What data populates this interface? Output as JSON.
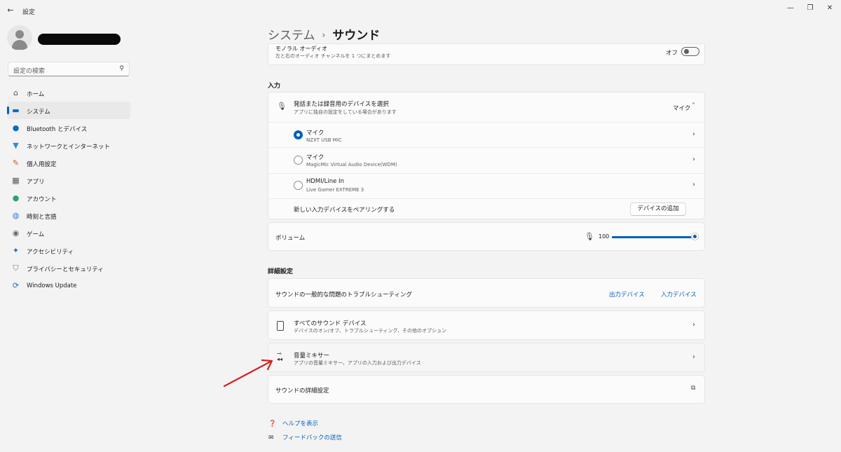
{
  "window": {
    "title": "設定"
  },
  "sidebar": {
    "search_placeholder": "設定の検索",
    "items": [
      {
        "label": "ホーム",
        "icon": "home-icon",
        "active": false
      },
      {
        "label": "システム",
        "icon": "system-icon",
        "active": true
      },
      {
        "label": "Bluetooth とデバイス",
        "icon": "bluetooth-icon",
        "active": false
      },
      {
        "label": "ネットワークとインターネット",
        "icon": "network-icon",
        "active": false
      },
      {
        "label": "個人用設定",
        "icon": "personalization-icon",
        "active": false
      },
      {
        "label": "アプリ",
        "icon": "apps-icon",
        "active": false
      },
      {
        "label": "アカウント",
        "icon": "account-icon",
        "active": false
      },
      {
        "label": "時刻と言語",
        "icon": "time-language-icon",
        "active": false
      },
      {
        "label": "ゲーム",
        "icon": "gaming-icon",
        "active": false
      },
      {
        "label": "アクセシビリティ",
        "icon": "accessibility-icon",
        "active": false
      },
      {
        "label": "プライバシーとセキュリティ",
        "icon": "privacy-icon",
        "active": false
      },
      {
        "label": "Windows Update",
        "icon": "windows-update-icon",
        "active": false
      }
    ]
  },
  "breadcrumb": {
    "parent": "システム",
    "separator": "›",
    "current": "サウンド"
  },
  "mono_audio": {
    "title": "モノラル オーディオ",
    "subtitle": "左と右のオーディオ チャンネルを 1 つにまとめます",
    "state_label": "オフ"
  },
  "input_section": {
    "heading": "入力",
    "device_select": {
      "title": "発話または録音用のデバイスを選択",
      "subtitle": "アプリに独自の設定をしている場合があります",
      "value": "マイク"
    },
    "devices": [
      {
        "name": "マイク",
        "detail": "NZXT USB MIC",
        "selected": true
      },
      {
        "name": "マイク",
        "detail": "MagicMic Virtual Audio Device(WDM)",
        "selected": false
      },
      {
        "name": "HDMI/Line In",
        "detail": "Live Gamer EXTREME 3",
        "selected": false
      }
    ],
    "pair": {
      "label": "新しい入力デバイスをペアリングする",
      "button": "デバイスの追加"
    },
    "volume": {
      "label": "ボリューム",
      "value": "100",
      "level": 1.0
    }
  },
  "advanced_section": {
    "heading": "詳細設定",
    "troubleshoot": {
      "label": "サウンドの一般的な問題のトラブルシューティング",
      "output_link": "出力デバイス",
      "input_link": "入力デバイス"
    },
    "all_devices": {
      "title": "すべてのサウンド デバイス",
      "subtitle": "デバイスのオン/オフ、トラブルシューティング、その他のオプション"
    },
    "mixer": {
      "title": "音量ミキサー",
      "subtitle": "アプリの音量ミキサー、アプリの入力および出力デバイス"
    },
    "more_settings": {
      "label": "サウンドの詳細設定"
    }
  },
  "footer": {
    "help": "ヘルプを表示",
    "feedback": "フィードバックの送信"
  },
  "colors": {
    "accent": "#005fb8",
    "annotation_arrow": "#d42020"
  }
}
